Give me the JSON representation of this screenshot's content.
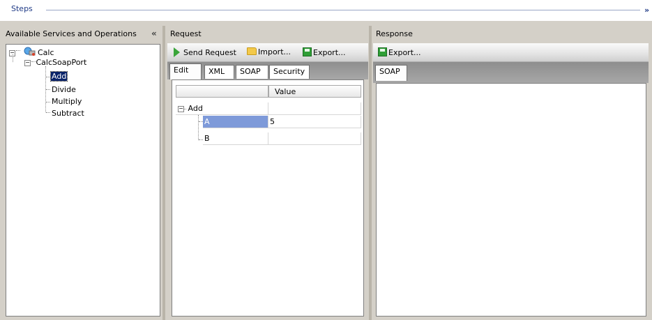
{
  "header": {
    "title": "Steps",
    "expand_glyph": "»"
  },
  "left_panel": {
    "title": "Available Services and Operations",
    "collapse_glyph": "«",
    "tree": {
      "service": "Calc",
      "port": "CalcSoapPort",
      "operations": [
        "Add",
        "Divide",
        "Multiply",
        "Subtract"
      ],
      "selected": "Add"
    }
  },
  "request": {
    "title": "Request",
    "toolbar": {
      "send": "Send Request",
      "import": "Import...",
      "export": "Export..."
    },
    "tabs": [
      "Edit",
      "XML",
      "SOAP",
      "Security"
    ],
    "active_tab": "Edit",
    "grid": {
      "value_header": "Value",
      "root": "Add",
      "rows": [
        {
          "name": "A",
          "value": "5"
        },
        {
          "name": "B",
          "value": ""
        }
      ]
    }
  },
  "response": {
    "title": "Response",
    "toolbar": {
      "export": "Export..."
    },
    "tabs": [
      "SOAP"
    ],
    "active_tab": "SOAP"
  },
  "colors": {
    "accent": "#1f3a86",
    "selection": "#0a246a",
    "cell_selected": "#7e9ad9"
  }
}
